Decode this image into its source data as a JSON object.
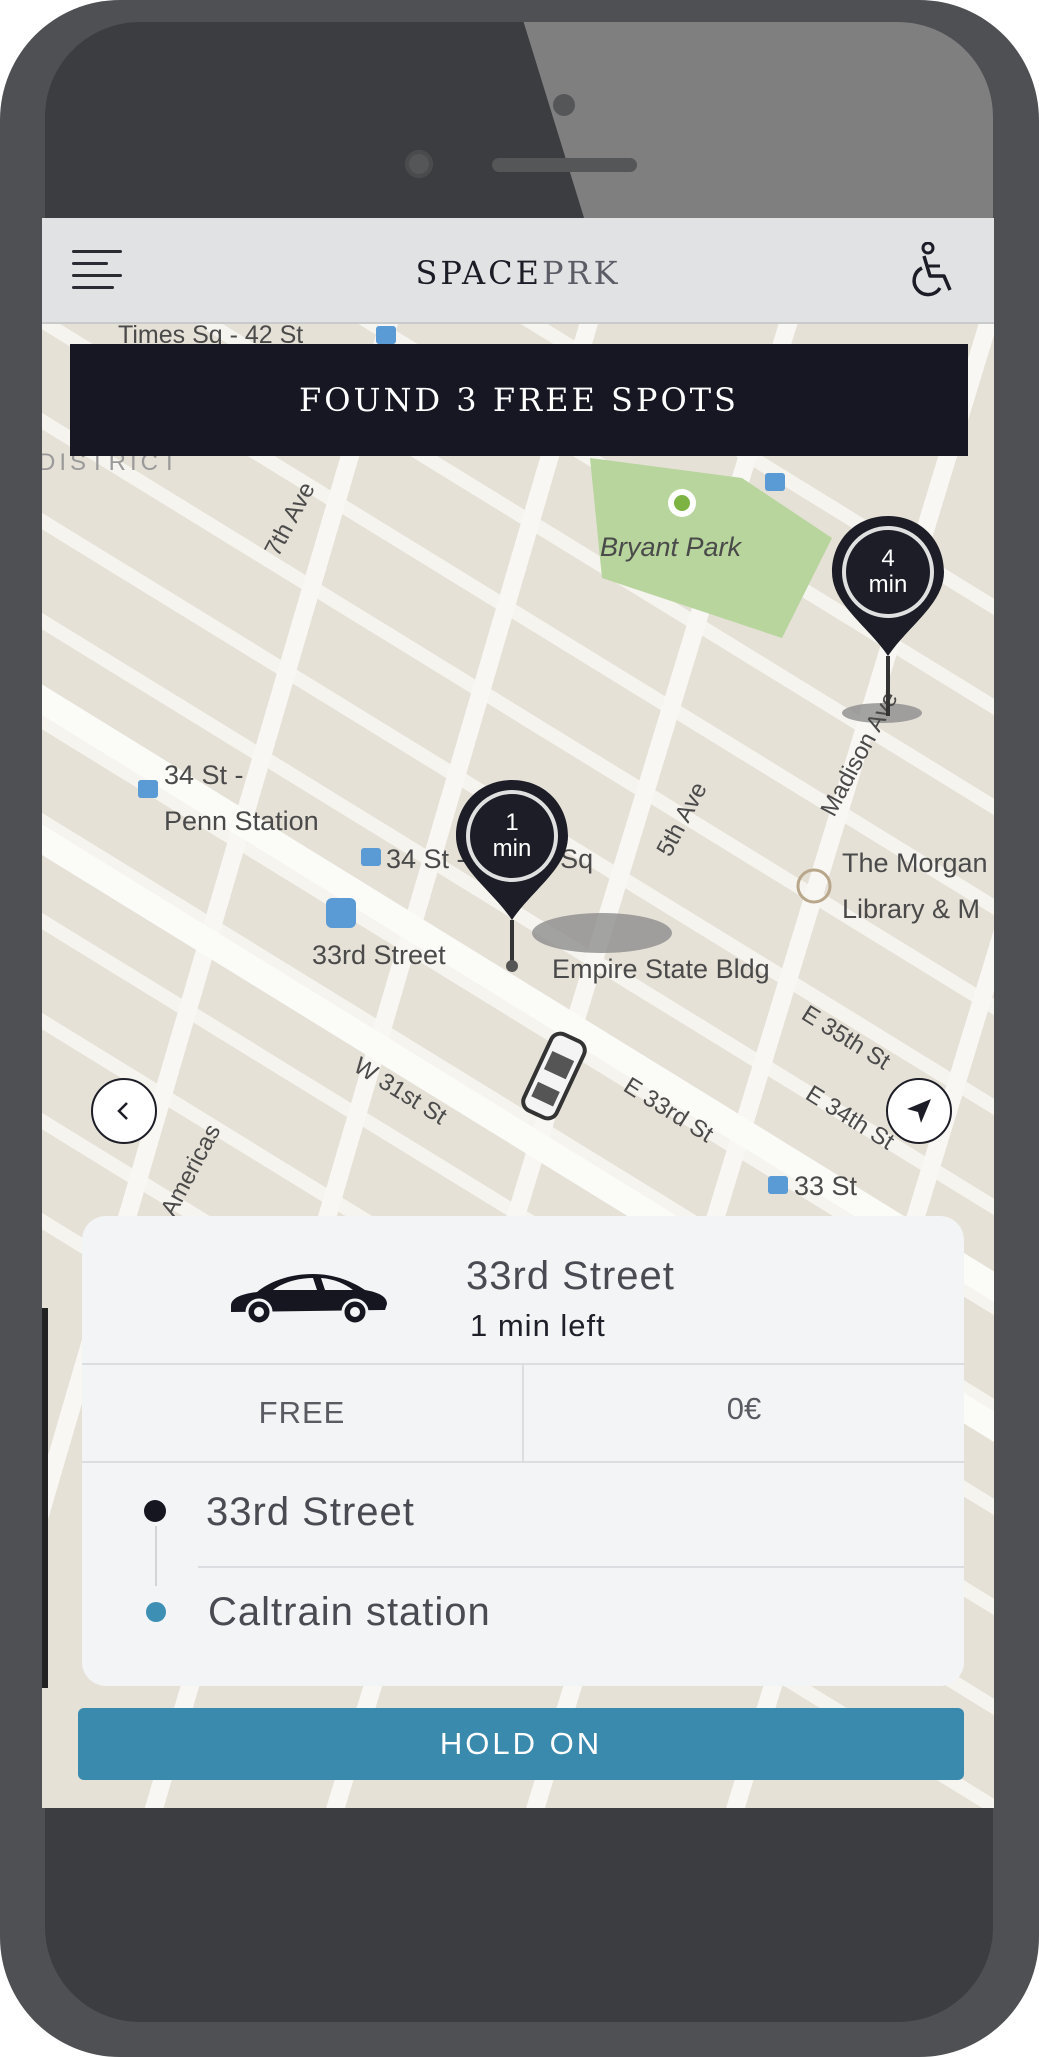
{
  "app": {
    "brand_part1": "SPACE",
    "brand_part2": "PRK",
    "menu_icon": "hamburger-menu-icon",
    "accessibility_icon": "wheelchair-icon"
  },
  "banner": {
    "text": "FOUND 3 FREE SPOTS"
  },
  "map": {
    "labels": {
      "times_sq": "Times Sq - 42 St",
      "district": "DISTRICT",
      "seventh_ave": "7th Ave",
      "bryant_park": "Bryant Park",
      "fifth_ave": "5th Ave",
      "madison_ave": "Madison Ave",
      "penn_34_line1": "34 St -",
      "penn_34_line2": "Penn Station",
      "herald_sq": "34 St - Herald Sq",
      "morgan_line1": "The Morgan",
      "morgan_line2": "Library & M",
      "thirty_third_street": "33rd Street",
      "empire_state": "Empire State Bldg",
      "e_35th": "E 35th St",
      "e_34th": "E 34th St",
      "e_33rd": "E 33rd St",
      "w_31st": "W 31st St",
      "americas": "Americas",
      "thirty_three_st": "33 St"
    },
    "pins": [
      {
        "number": "4",
        "unit": "min"
      },
      {
        "number": "1",
        "unit": "min"
      }
    ]
  },
  "card": {
    "title": "33rd Street",
    "time_left": "1 min left",
    "price_type": "FREE",
    "price_value": "0€",
    "route_from": "33rd Street",
    "route_to": "Caltrain station"
  },
  "actions": {
    "hold_on": "HOLD ON"
  },
  "colors": {
    "accent": "#3a8aae",
    "dark": "#161722",
    "route_dot_to": "#3d8fb3"
  }
}
